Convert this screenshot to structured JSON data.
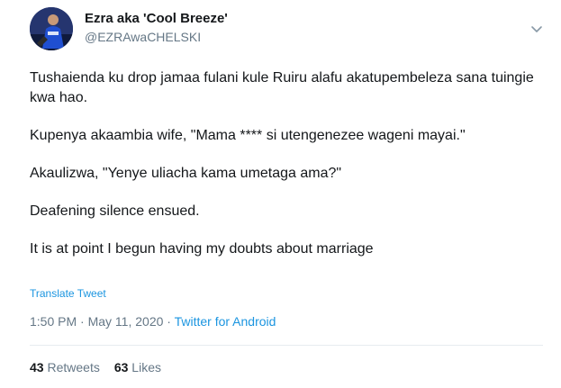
{
  "user": {
    "display_name": "Ezra aka 'Cool Breeze'",
    "handle": "@EZRAwaCHELSKI",
    "avatar_icon": "profile-photo",
    "menu_icon": "chevron-down-icon"
  },
  "tweet": {
    "paragraphs": [
      "Tushaienda ku drop jamaa fulani kule Ruiru alafu akatupembeleza sana tuingie kwa hao.",
      "Kupenya akaambia wife, \"Mama **** si utengenezee wageni mayai.\"",
      "Akaulizwa, \"Yenye uliacha kama umetaga ama?\"",
      "Deafening silence ensued.",
      "It is at point I begun having my doubts about marriage"
    ],
    "translate_label": "Translate Tweet",
    "time": "1:50 PM",
    "separator": "·",
    "date": "May 11, 2020",
    "source": "Twitter for Android"
  },
  "stats": {
    "retweets_count": "43",
    "retweets_label": "Retweets",
    "likes_count": "63",
    "likes_label": "Likes"
  },
  "colors": {
    "link": "#1b95e0",
    "secondary_text": "#657786",
    "primary_text": "#14171a",
    "divider": "#e6ecf0"
  }
}
